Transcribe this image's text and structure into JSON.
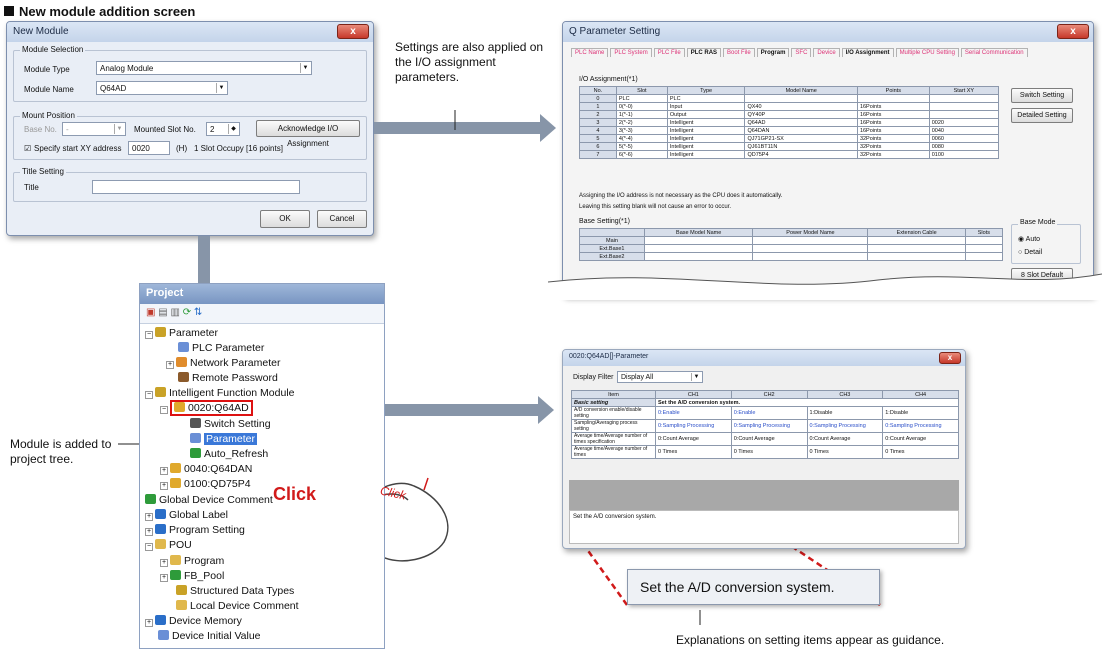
{
  "heading": "New module addition screen",
  "new_module": {
    "title": "New Module",
    "close": "x",
    "module_selection_label": "Module Selection",
    "module_type_label": "Module Type",
    "module_type_value": "Analog Module",
    "module_name_label": "Module Name",
    "module_name_value": "Q64AD",
    "mount_position_label": "Mount Position",
    "base_no_label": "Base No.",
    "base_no_value": "-",
    "mounted_slot_label": "Mounted Slot No.",
    "mounted_slot_value": "2",
    "ack_button": "Acknowledge I/O Assignment",
    "specify_label": "Specify start XY address",
    "start_xy_value": "0020",
    "h_label": "(H)",
    "occupy_label": "1 Slot Occupy [16 points]",
    "title_setting_label": "Title Setting",
    "title_label": "Title",
    "title_value": "",
    "ok": "OK",
    "cancel": "Cancel"
  },
  "annotation_settings": "Settings are also applied on the I/O assignment parameters.",
  "qps": {
    "title": "Q Parameter Setting",
    "tabs": [
      "PLC Name",
      "PLC System",
      "PLC File",
      "PLC RAS",
      "Boot File",
      "Program",
      "SFC",
      "Device",
      "I/O Assignment",
      "Multiple CPU Setting",
      "Serial Communication"
    ],
    "io_label": "I/O Assignment(*1)",
    "io_headers": [
      "No.",
      "Slot",
      "Type",
      "Model Name",
      "Points",
      "Start XY"
    ],
    "io_rows": [
      [
        "0",
        "PLC",
        "PLC",
        "",
        "",
        ""
      ],
      [
        "1",
        "0(*-0)",
        "Input",
        "QX40",
        "16Points",
        ""
      ],
      [
        "2",
        "1(*-1)",
        "Output",
        "QY40P",
        "16Points",
        ""
      ],
      [
        "3",
        "2(*-2)",
        "Intelligent",
        "Q64AD",
        "16Points",
        "0020"
      ],
      [
        "4",
        "3(*-3)",
        "Intelligent",
        "Q64DAN",
        "16Points",
        "0040"
      ],
      [
        "5",
        "4(*-4)",
        "Intelligent",
        "QJ71GP21-SX",
        "32Points",
        "0060"
      ],
      [
        "6",
        "5(*-5)",
        "Intelligent",
        "QJ61BT11N",
        "32Points",
        "0080"
      ],
      [
        "7",
        "6(*-6)",
        "Intelligent",
        "QD75P4",
        "32Points",
        "0100"
      ]
    ],
    "switch_setting": "Switch Setting",
    "detailed_setting": "Detailed Setting",
    "note1": "Assigning the I/O address is not necessary as the CPU does it automatically.",
    "note2": "Leaving this setting blank will not cause an error to occur.",
    "base_label": "Base Setting(*1)",
    "base_headers": [
      "",
      "Base Model Name",
      "Power Model Name",
      "Extension Cable",
      "Slots"
    ],
    "base_rows": [
      "Main",
      "Ext.Base1",
      "Ext.Base2"
    ],
    "base_mode": "Base Mode",
    "auto": "Auto",
    "detail": "Detail",
    "slot_default": "8 Slot Default"
  },
  "project": {
    "title": "Project",
    "nodes": {
      "parameter": "Parameter",
      "plc_parameter": "PLC Parameter",
      "network_parameter": "Network Parameter",
      "remote_password": "Remote Password",
      "ifm": "Intelligent Function Module",
      "q64ad": "0020:Q64AD",
      "switch_setting": "Switch Setting",
      "parameter_sel": "Parameter",
      "auto_refresh": "Auto_Refresh",
      "q64da": "0040:Q64DAN",
      "qd75": "0100:QD75P4",
      "gdc": "Global Device Comment",
      "global_label": "Global Label",
      "program_setting": "Program Setting",
      "pou": "POU",
      "program": "Program",
      "fb_pool": "FB_Pool",
      "sdt": "Structured Data Types",
      "ldc": "Local Device Comment",
      "device_memory": "Device Memory",
      "device_initial": "Device Initial Value"
    }
  },
  "annotation_added": "Module is added to project tree.",
  "click_label": "Click",
  "click_label2": "Click",
  "param": {
    "title": "0020:Q64AD[]-Parameter",
    "display_filter_label": "Display Filter",
    "display_filter_value": "Display All",
    "headers": [
      "Item",
      "CH1",
      "CH2",
      "CH3",
      "CH4"
    ],
    "basic": "Basic setting",
    "basic_text": "Set the A/D conversion system.",
    "rows": [
      [
        "A/D conversion enable/disable setting",
        "0:Enable",
        "0:Enable",
        "1:Disable",
        "1:Disable"
      ],
      [
        "Sampling/Averaging process setting",
        "0:Sampling Processing",
        "0:Sampling Processing",
        "0:Sampling Processing",
        "0:Sampling Processing"
      ],
      [
        "Average time/Average number of times specification",
        "0:Count Average",
        "0:Count Average",
        "0:Count Average",
        "0:Count Average"
      ],
      [
        "Average time/Average number of times",
        "0 Times",
        "0 Times",
        "0 Times",
        "0 Times"
      ]
    ],
    "guidance": "Set the A/D conversion system."
  },
  "tooltip": "Set the A/D conversion system.",
  "annotation_guidance": "Explanations on setting items appear as guidance.",
  "colors": {
    "arrow": "#8795a8",
    "highlight": "#d11a1a"
  }
}
